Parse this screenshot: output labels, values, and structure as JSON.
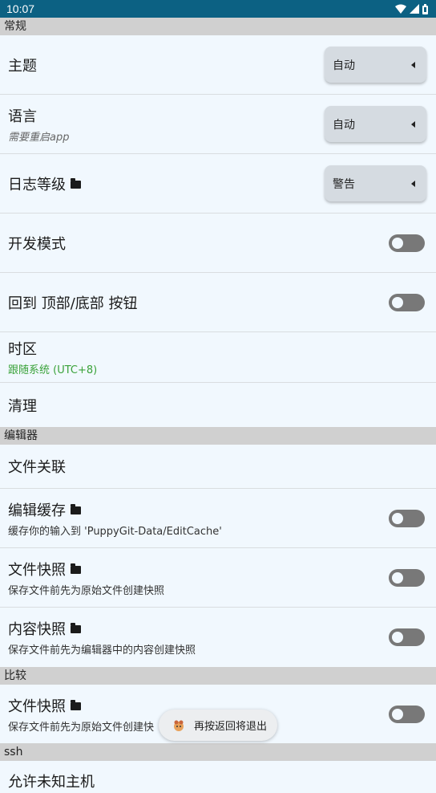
{
  "status_bar": {
    "time": "10:07",
    "icons": [
      "wifi-icon",
      "signal-icon",
      "battery-icon"
    ]
  },
  "sections": {
    "general": "常规",
    "editor": "编辑器",
    "compare": "比较",
    "ssh": "ssh"
  },
  "general": {
    "theme": {
      "title": "主题",
      "value": "自动"
    },
    "language": {
      "title": "语言",
      "subtitle": "需要重启app",
      "value": "自动"
    },
    "log_level": {
      "title": "日志等级",
      "value": "警告"
    },
    "dev_mode": {
      "title": "开发模式",
      "enabled": false
    },
    "back_top_bottom": {
      "title": "回到 顶部/底部 按钮",
      "enabled": false
    },
    "timezone": {
      "title": "时区",
      "subtitle": "跟随系统 (UTC+8)"
    },
    "cleanup": {
      "title": "清理"
    }
  },
  "editor": {
    "file_assoc": {
      "title": "文件关联"
    },
    "edit_cache": {
      "title": "编辑缓存",
      "subtitle": "缓存你的输入到 'PuppyGit-Data/EditCache'",
      "enabled": false
    },
    "file_snapshot": {
      "title": "文件快照",
      "subtitle": "保存文件前先为原始文件创建快照",
      "enabled": false
    },
    "content_snapshot": {
      "title": "内容快照",
      "subtitle": "保存文件前先为编辑器中的内容创建快照",
      "enabled": false
    }
  },
  "compare": {
    "file_snapshot": {
      "title": "文件快照",
      "subtitle": "保存文件前先为原始文件创建快",
      "enabled": false
    }
  },
  "ssh": {
    "partial_title": "允许未知主机"
  },
  "toast": {
    "text": "再按返回将退出"
  },
  "colors": {
    "status_bar": "#0c6183",
    "background": "#f1f8fe",
    "section_header": "#d0d0d0",
    "toggle_off": "#787878",
    "accent_green": "#3aa23a"
  }
}
